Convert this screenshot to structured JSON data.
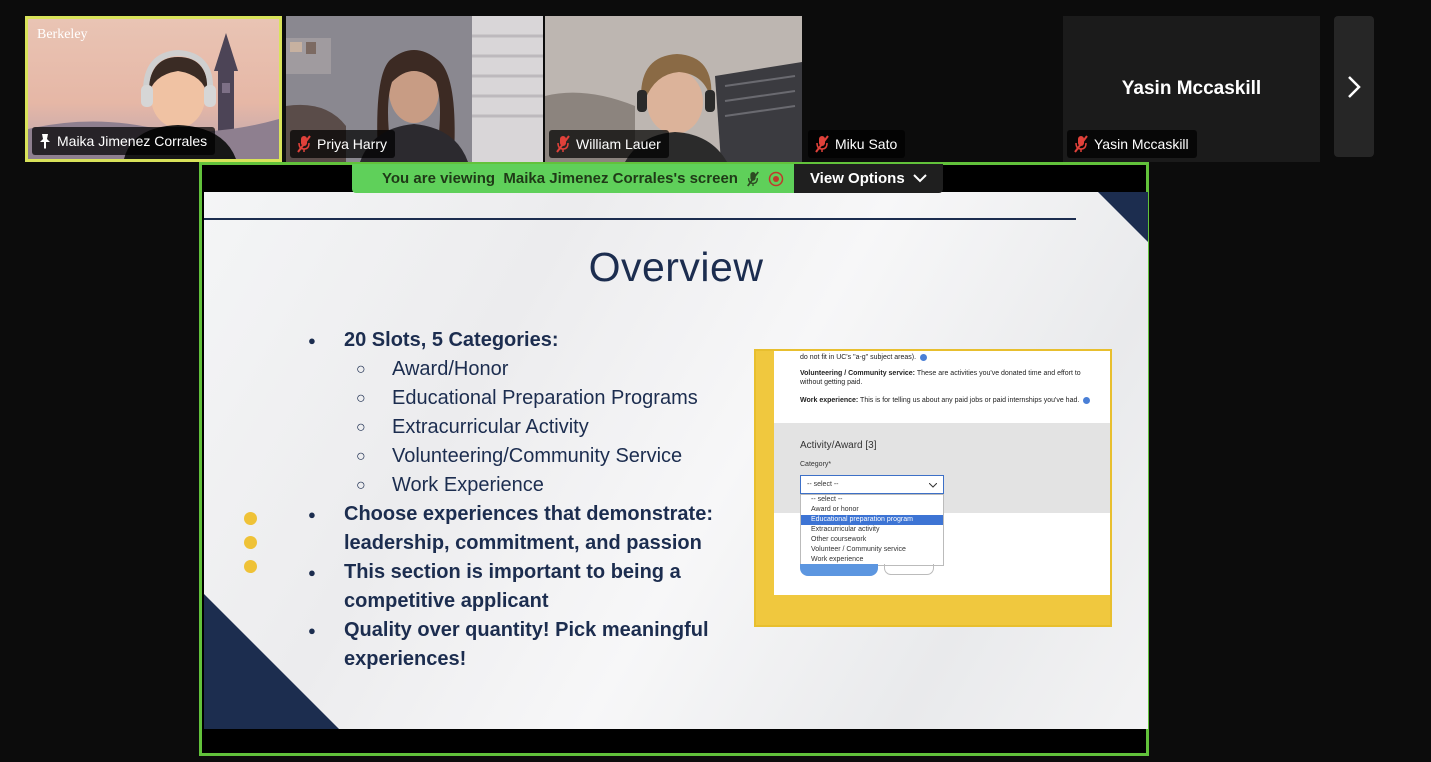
{
  "participants": [
    {
      "name": "Maika Jimenez Corrales",
      "pinned": true,
      "muted": false,
      "video": true,
      "active": true,
      "logo_text": "Berkeley"
    },
    {
      "name": "Priya Harry",
      "pinned": false,
      "muted": true,
      "video": true,
      "active": false
    },
    {
      "name": "William Lauer",
      "pinned": false,
      "muted": true,
      "video": true,
      "active": false
    },
    {
      "name": "Miku Sato",
      "pinned": false,
      "muted": true,
      "video": false,
      "active": false
    },
    {
      "name": "Yasin Mccaskill",
      "pinned": false,
      "muted": true,
      "video": false,
      "active": false
    }
  ],
  "banner": {
    "viewing_text": "You are viewing  Maika Jimenez Corrales's screen",
    "view_options": "View Options"
  },
  "slide": {
    "title": "Overview",
    "bullets": [
      {
        "text": "20 Slots, 5 Categories:",
        "sub": [
          "Award/Honor",
          "Educational Preparation Programs",
          "Extracurricular Activity",
          "Volunteering/Community Service",
          "Work Experience"
        ]
      },
      {
        "text": "Choose experiences that demonstrate: leadership, commitment, and passion"
      },
      {
        "text": "This section is important to being a competitive applicant"
      },
      {
        "text": "Quality over quantity! Pick meaningful experiences!"
      }
    ],
    "screenshot": {
      "line1": "do not fit in UC's \"a-g\" subject areas).",
      "line2_bold": "Volunteering / Community service:",
      "line2": " These are activities you've donated time and effort to without getting paid.",
      "line3_bold": "Work experience:",
      "line3": " This is for telling us about any paid jobs or paid internships you've had.",
      "section_title": "Activity/Award [3]",
      "category_label": "Category*",
      "select_value": "-- select --",
      "options": [
        "-- select --",
        "Award or honor",
        "Educational preparation program",
        "Extracurricular activity",
        "Other coursework",
        "Volunteer / Community service",
        "Work experience"
      ],
      "highlighted_option": "Educational preparation program"
    }
  },
  "colors": {
    "active_speaker": "#d9e35a",
    "share_border": "#62c23b",
    "banner_green": "#5fd05a",
    "slide_navy": "#1c2d4f",
    "slide_gold": "#efc237",
    "muted_red": "#e0413a"
  }
}
